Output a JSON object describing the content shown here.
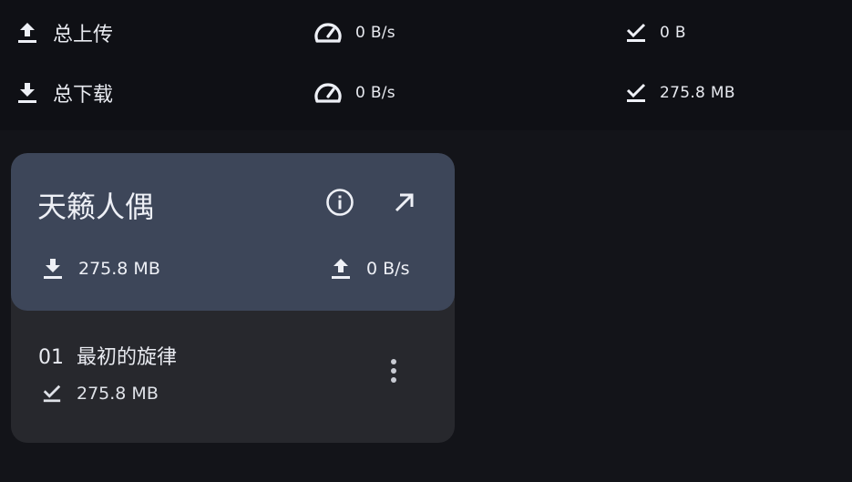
{
  "stats": {
    "upload": {
      "label": "总上传",
      "speed": "0 B/s",
      "total": "0 B"
    },
    "download": {
      "label": "总下载",
      "speed": "0 B/s",
      "total": "275.8 MB"
    }
  },
  "album": {
    "title": "天籁人偶",
    "downloaded": "275.8 MB",
    "upload_speed": "0 B/s"
  },
  "tracks": [
    {
      "number": "01",
      "title": "最初的旋律",
      "size": "275.8 MB"
    }
  ],
  "colors": {
    "page_bg": "#131419",
    "stats_bg": "#0f1015",
    "card_head_bg": "#3d4659",
    "card_body_bg": "#27282d",
    "text": "#e8eaf0"
  },
  "icons": {
    "upload": "upload-icon",
    "download": "download-icon",
    "speed": "speedometer-icon",
    "done": "check-underline-icon",
    "info": "info-icon",
    "open": "open-external-icon",
    "more": "more-vertical-icon"
  }
}
